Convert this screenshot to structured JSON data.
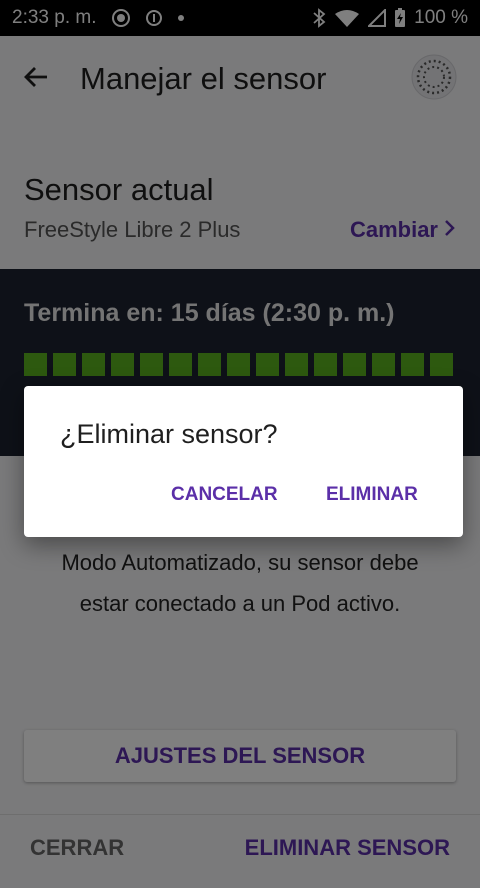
{
  "status_bar": {
    "time": "2:33 p. m.",
    "battery": "100 %"
  },
  "app_bar": {
    "title": "Manejar el sensor"
  },
  "sensor": {
    "section_title": "Sensor actual",
    "name": "FreeStyle Libre 2 Plus",
    "change_label": "Cambiar",
    "ends_text": "Termina en: 15 días (2:30 p. m.)",
    "days_bar_count": 15,
    "days_bar_color": "#5ab21e"
  },
  "body": {
    "line1": "Modo Automatizado, su sensor debe",
    "line2": "estar conectado a un Pod activo."
  },
  "settings_button_label": "AJUSTES DEL SENSOR",
  "footer": {
    "close_label": "CERRAR",
    "remove_label": "ELIMINAR SENSOR"
  },
  "dialog": {
    "title": "¿Eliminar sensor?",
    "cancel_label": "CANCELAR",
    "confirm_label": "ELIMINAR"
  },
  "colors": {
    "accent": "#5b2fa8",
    "dark_panel": "#1d2330"
  }
}
